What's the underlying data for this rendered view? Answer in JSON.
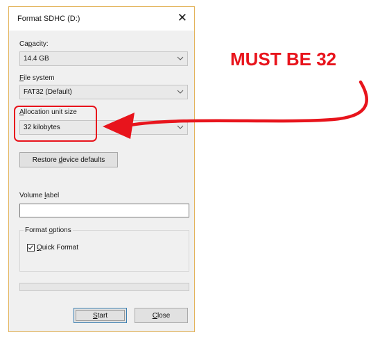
{
  "dialog": {
    "title": "Format SDHC (D:)",
    "close_glyph": "✕",
    "capacity": {
      "label_pre": "Ca",
      "label_key": "p",
      "label_post": "acity:",
      "value": "14.4 GB"
    },
    "file_system": {
      "label_pre": "",
      "label_key": "F",
      "label_post": "ile system",
      "value": "FAT32 (Default)"
    },
    "allocation_unit": {
      "label_pre": "",
      "label_key": "A",
      "label_post": "llocation unit size",
      "value": "32 kilobytes"
    },
    "restore_button": {
      "label_pre": "Restore ",
      "label_key": "d",
      "label_post": "evice defaults"
    },
    "volume_label": {
      "label_pre": "Volume ",
      "label_key": "l",
      "label_post": "abel",
      "value": ""
    },
    "format_options": {
      "legend_pre": "Format ",
      "legend_key": "o",
      "legend_post": "ptions",
      "quick_format": {
        "label_pre": "",
        "label_key": "Q",
        "label_post": "uick Format",
        "checked": true
      }
    },
    "progress": {
      "value": 0
    },
    "start_button": {
      "label_pre": "",
      "label_key": "S",
      "label_post": "tart"
    },
    "close_button": {
      "label_pre": "",
      "label_key": "C",
      "label_post": "lose"
    }
  },
  "annotation": {
    "text": "MUST BE 32",
    "color": "#e8141c"
  },
  "icons": {
    "dropdown": "chevron-down-icon",
    "close": "close-icon",
    "check": "check-icon",
    "arrow": "arrow-icon"
  }
}
